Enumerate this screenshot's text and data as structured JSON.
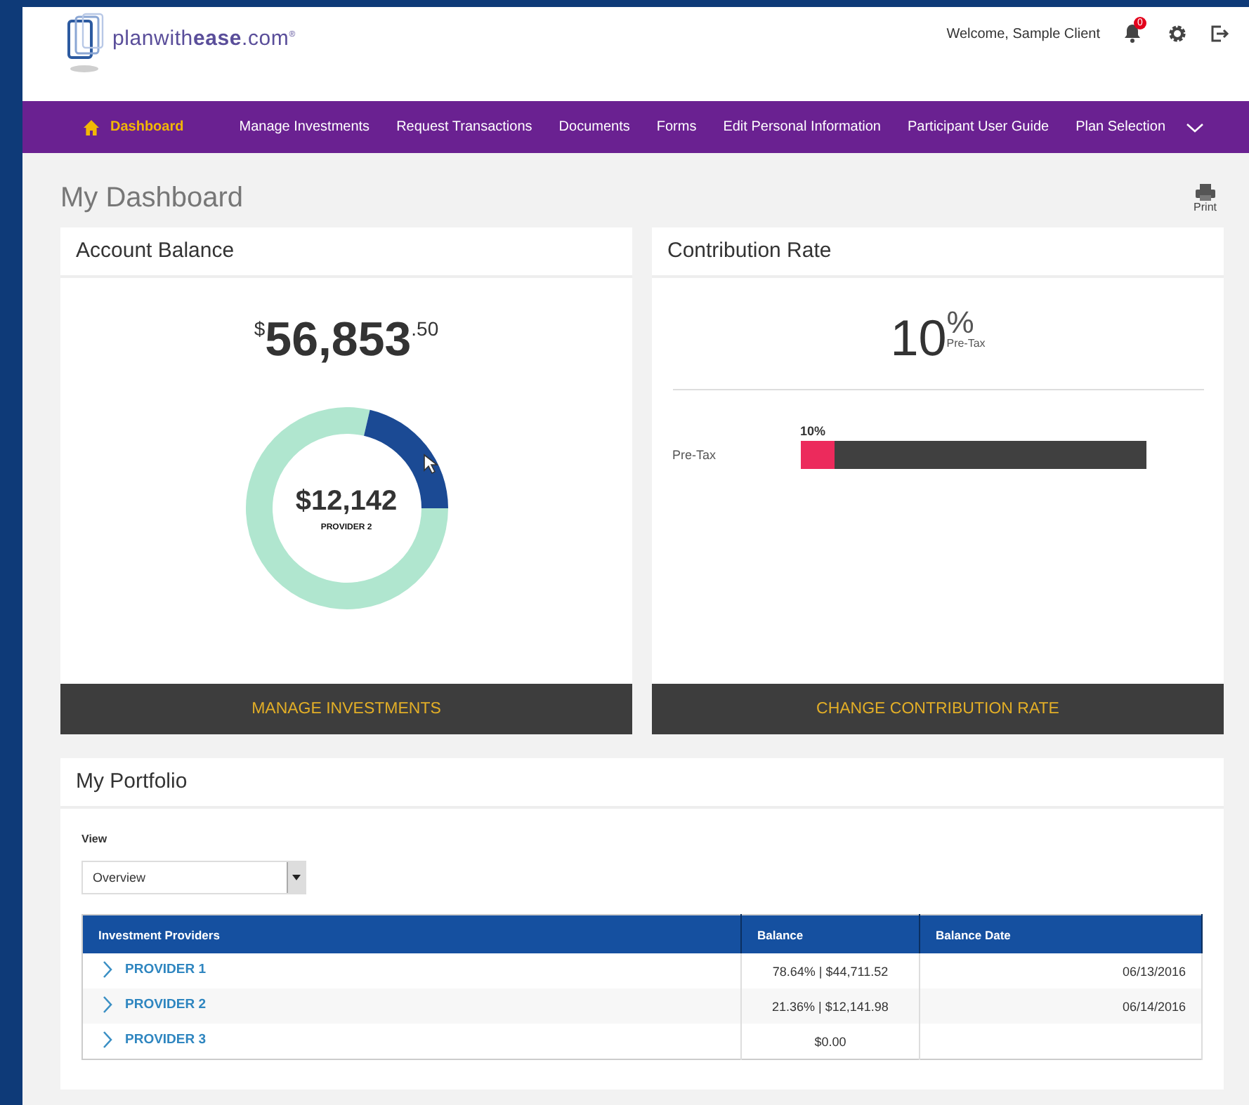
{
  "header": {
    "logo": "planwith**ease**.com$^{®}$",
    "welcome": "Welcome,  Sample Client",
    "notification_count": "0"
  },
  "nav": [
    {
      "label": "Dashboard",
      "selected": true,
      "kind": "home"
    },
    {
      "label": "Manage Investments",
      "selected": false,
      "kind": "plain"
    },
    {
      "label": "Request Transactions",
      "selected": false,
      "kind": "plain"
    },
    {
      "label": "Documents",
      "selected": false,
      "kind": "plain"
    },
    {
      "label": "Forms",
      "selected": false,
      "kind": "plain"
    },
    {
      "label": "Edit Personal Information",
      "selected": false,
      "kind": "plain"
    },
    {
      "label": "Participant User Guide",
      "selected": false,
      "kind": "plain"
    },
    {
      "label": "Plan Selection",
      "selected": false,
      "kind": "dropdown"
    }
  ],
  "page_title": "My Dashboard",
  "print_label": "Print",
  "account_balance": {
    "title": "Account Balance",
    "currency": "$",
    "whole": "56,853",
    "cents": ".50",
    "center_amount": "$12,142",
    "center_label": "PROVIDER 2",
    "chart_data": {
      "type": "donut",
      "values": [
        78.64,
        21.36
      ]
    },
    "button": "MANAGE INVESTMENTS"
  },
  "contribution_rate": {
    "title": "Contribution Rate",
    "rate": "10",
    "percent_sign": "%",
    "rate_label": "Pre-Tax",
    "bars": [
      {
        "label": "Pre-Tax",
        "value": "10%",
        "level": 0.1
      }
    ],
    "button": "CHANGE CONTRIBUTION RATE"
  },
  "portfolio": {
    "title": "My Portfolio",
    "view_label": "View",
    "view_value": "Overview",
    "columns": [
      "Investment Providers",
      "Balance",
      "Balance Date"
    ],
    "rows": [
      {
        "provider": "PROVIDER 1",
        "balance": "78.64%  |  $44,711.52",
        "date": "06/13/2016"
      },
      {
        "provider": "PROVIDER 2",
        "balance": "21.36%  |  $12,141.98",
        "date": "06/14/2016"
      },
      {
        "provider": "PROVIDER 3",
        "balance": "$0.00"
      }
    ]
  }
}
